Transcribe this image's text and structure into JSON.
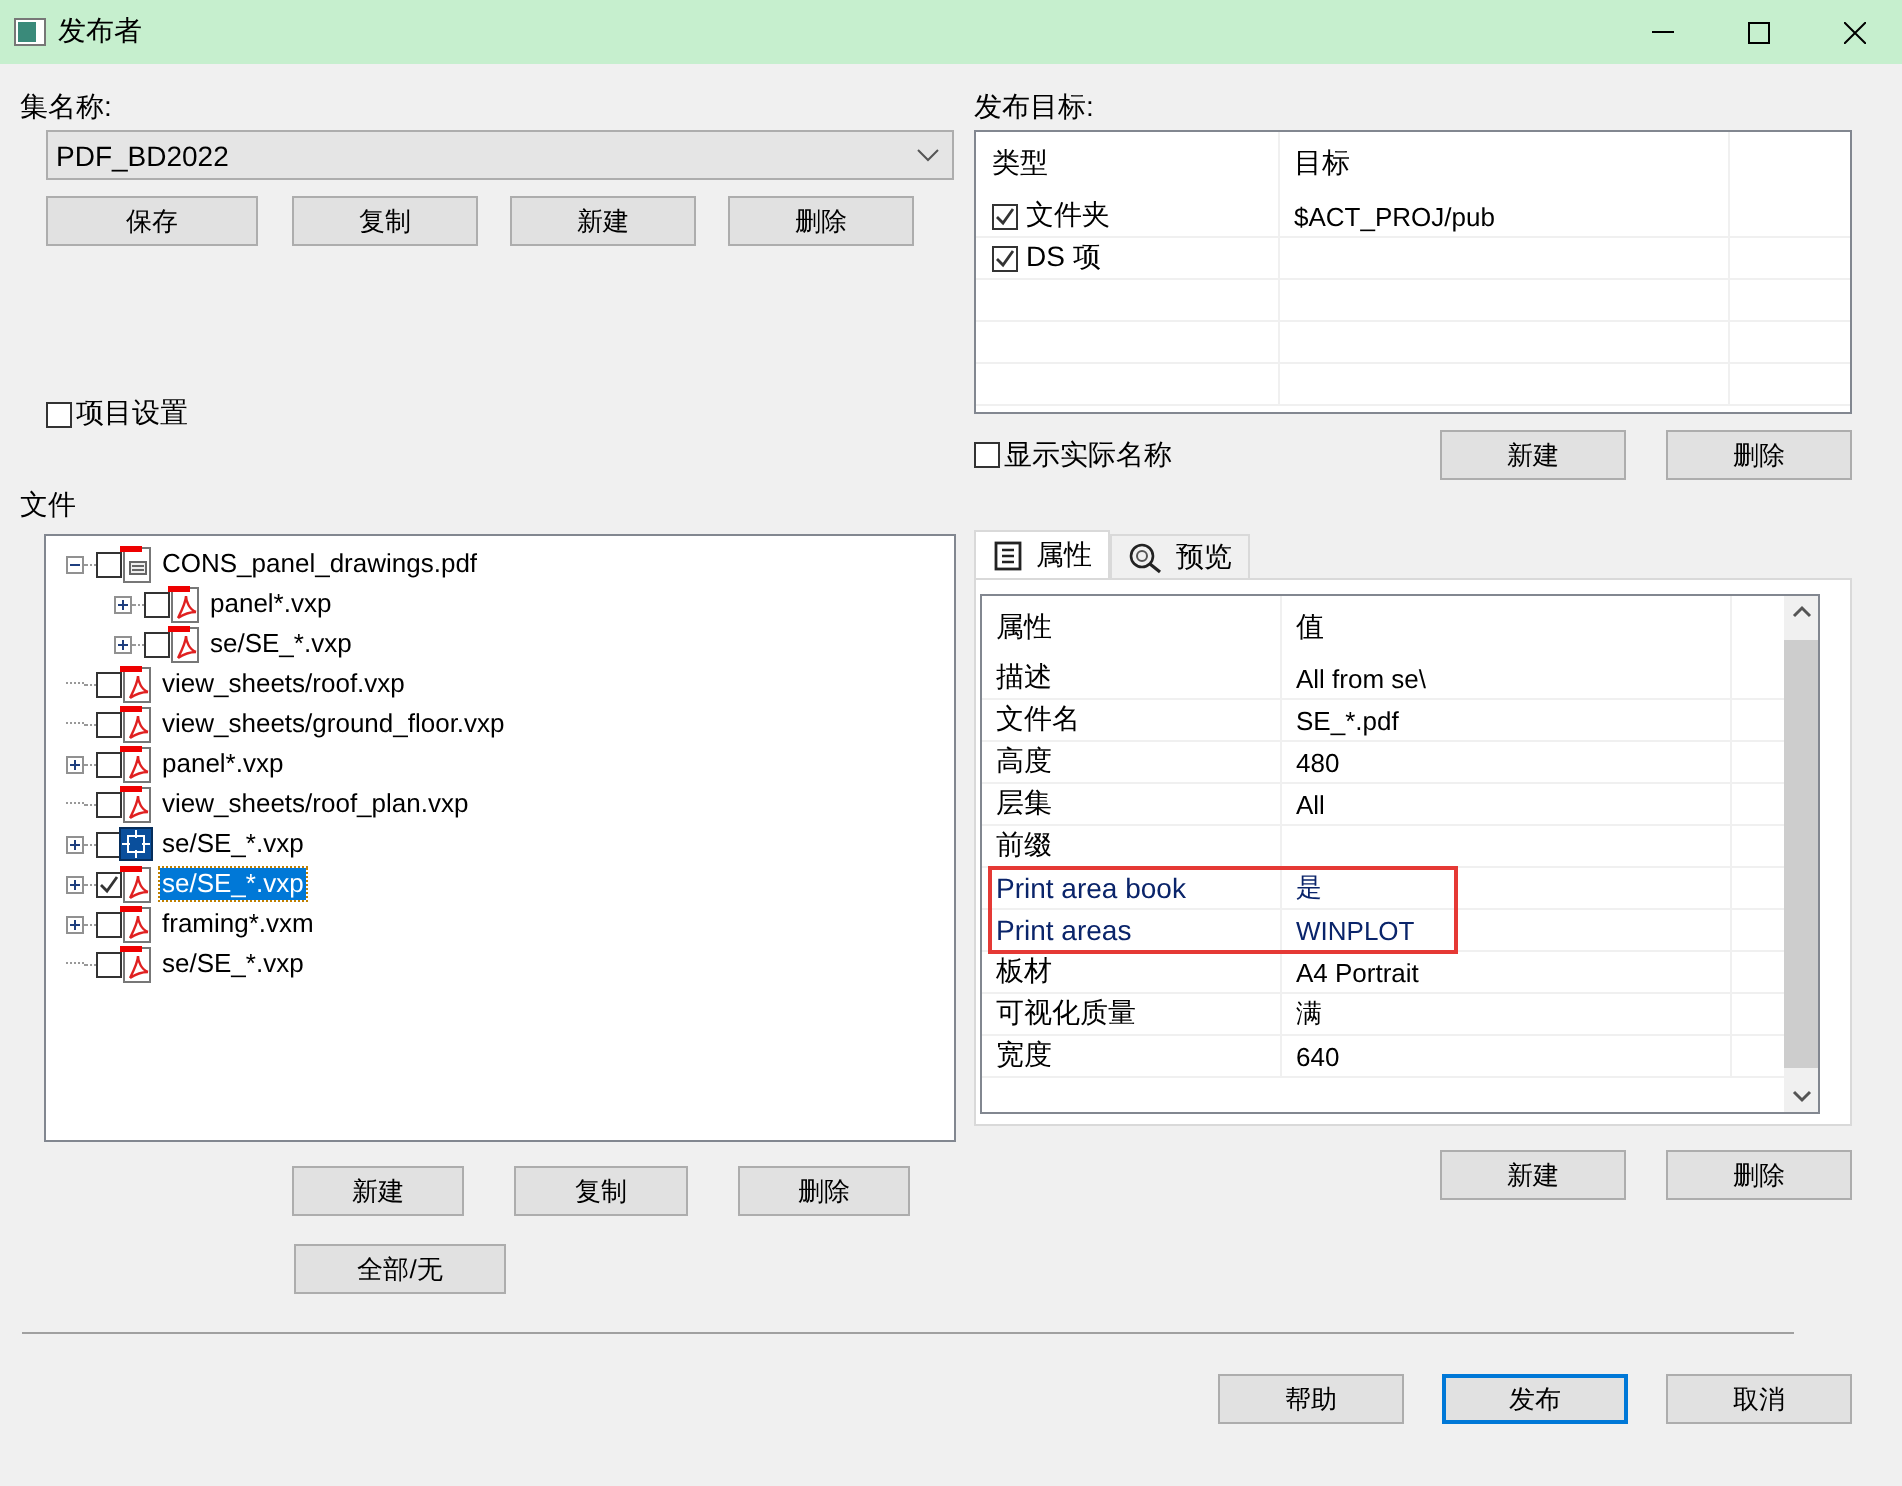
{
  "window": {
    "title": "发布者"
  },
  "set_name": {
    "label": "集名称:",
    "value": "PDF_BD2022",
    "buttons": [
      "保存",
      "复制",
      "新建",
      "删除"
    ]
  },
  "project_settings": {
    "label": "项目设置",
    "checked": false
  },
  "files": {
    "label": "文件",
    "tree": [
      {
        "label": "CONS_panel_drawings.pdf",
        "kind": "book",
        "checked": false,
        "selected": false,
        "expanded": true,
        "children": [
          {
            "label": "panel*.vxp",
            "kind": "pdf",
            "checked": false,
            "selected": false,
            "expanded": false
          },
          {
            "label": "se/SE_*.vxp",
            "kind": "pdf",
            "checked": false,
            "selected": false,
            "expanded": false
          }
        ]
      },
      {
        "label": "view_sheets/roof.vxp",
        "kind": "pdf",
        "checked": false,
        "selected": false
      },
      {
        "label": "view_sheets/ground_floor.vxp",
        "kind": "pdf",
        "checked": false,
        "selected": false
      },
      {
        "label": "panel*.vxp",
        "kind": "pdf",
        "checked": false,
        "selected": false,
        "expanded": false
      },
      {
        "label": "view_sheets/roof_plan.vxp",
        "kind": "pdf",
        "checked": false,
        "selected": false
      },
      {
        "label": "se/SE_*.vxp",
        "kind": "model",
        "checked": false,
        "selected": false,
        "expanded": false
      },
      {
        "label": "se/SE_*.vxp",
        "kind": "pdf",
        "checked": true,
        "selected": true,
        "expanded": false
      },
      {
        "label": "framing*.vxm",
        "kind": "pdf",
        "checked": false,
        "selected": false,
        "expanded": false
      },
      {
        "label": "se/SE_*.vxp",
        "kind": "pdf",
        "checked": false,
        "selected": false
      }
    ],
    "buttons": [
      "新建",
      "复制",
      "删除"
    ],
    "all_none_button": "全部/无"
  },
  "targets": {
    "label": "发布目标:",
    "columns": [
      "类型",
      "目标"
    ],
    "rows": [
      {
        "type": "文件夹",
        "checked": true,
        "target": "$ACT_PROJ/pub"
      },
      {
        "type": "DS 项",
        "checked": true
      }
    ],
    "show_real_names": {
      "label": "显示实际名称",
      "checked": false
    },
    "buttons": [
      "新建",
      "删除"
    ]
  },
  "tabs": [
    {
      "label": "属性",
      "kind": "list",
      "selected": true
    },
    {
      "label": "预览",
      "kind": "zoom",
      "selected": false
    }
  ],
  "properties": {
    "columns": [
      "属性",
      "值"
    ],
    "rows": [
      {
        "name": "描述",
        "value": "All from se\\",
        "highlighted": false
      },
      {
        "name": "文件名",
        "value": "SE_*.pdf",
        "highlighted": false
      },
      {
        "name": "高度",
        "value": "480",
        "highlighted": false
      },
      {
        "name": "层集",
        "value": "All",
        "highlighted": false
      },
      {
        "name": "前缀",
        "highlighted": false
      },
      {
        "name": "Print area book",
        "value": "是",
        "highlighted": true
      },
      {
        "name": "Print areas",
        "value": "WINPLOT",
        "highlighted": true
      },
      {
        "name": "板材",
        "value": "A4 Portrait",
        "highlighted": false
      },
      {
        "name": "可视化质量",
        "value": "满",
        "highlighted": false
      },
      {
        "name": "宽度",
        "value": "640",
        "highlighted": false
      }
    ],
    "buttons": [
      "新建",
      "删除"
    ]
  },
  "footer_buttons": [
    {
      "label": "帮助",
      "default": false
    },
    {
      "label": "发布",
      "default": true
    },
    {
      "label": "取消",
      "default": false
    }
  ]
}
